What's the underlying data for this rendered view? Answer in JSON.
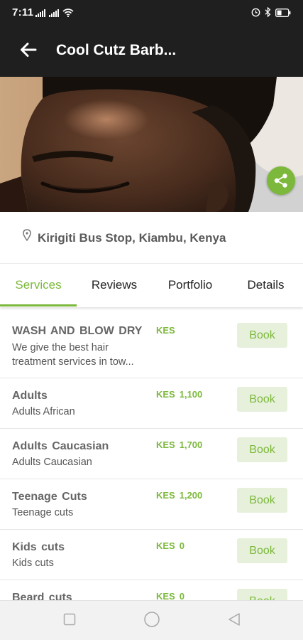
{
  "status_bar": {
    "time": "7:11",
    "signal_icon": "signal-bars-icon",
    "wifi_icon": "wifi-icon",
    "alarm_icon": "alarm-icon",
    "bluetooth_icon": "bluetooth-icon",
    "battery_icon": "battery-icon"
  },
  "app_bar": {
    "back_icon": "arrow-left-icon",
    "title": "Cool Cutz Barb..."
  },
  "hero": {
    "image": "barber-haircut-photo",
    "share_icon": "share-icon"
  },
  "location": {
    "icon": "map-pin-icon",
    "text": "Kirigiti Bus Stop, Kiambu, Kenya"
  },
  "tabs": [
    {
      "label": "Services",
      "active": true
    },
    {
      "label": "Reviews",
      "active": false
    },
    {
      "label": "Portfolio",
      "active": false
    },
    {
      "label": "Details",
      "active": false
    }
  ],
  "services": [
    {
      "name": "WASH AND BLOW DRY",
      "description": "We give the best hair treatment services in tow...",
      "currency": "KES",
      "price": "",
      "book_label": "Book"
    },
    {
      "name": "Adults",
      "description": "Adults African",
      "currency": "KES",
      "price": "1,100",
      "book_label": "Book"
    },
    {
      "name": "Adults  Caucasian",
      "description": "Adults Caucasian",
      "currency": "KES",
      "price": "1,700",
      "book_label": "Book"
    },
    {
      "name": "Teenage  Cuts",
      "description": "Teenage cuts",
      "currency": "KES",
      "price": "1,200",
      "book_label": "Book"
    },
    {
      "name": "Kids  cuts",
      "description": "Kids  cuts",
      "currency": "KES",
      "price": "0",
      "book_label": "Book"
    },
    {
      "name": "Beard  cuts",
      "description": "",
      "currency": "KES",
      "price": "0",
      "book_label": "Book"
    }
  ],
  "nav_bar": {
    "recents_icon": "square-recents-icon",
    "home_icon": "circle-home-icon",
    "back_icon": "triangle-back-icon"
  },
  "colors": {
    "accent": "#7cb83b",
    "book_bg": "#e6f0db",
    "bar_bg": "#1f1f1f"
  }
}
